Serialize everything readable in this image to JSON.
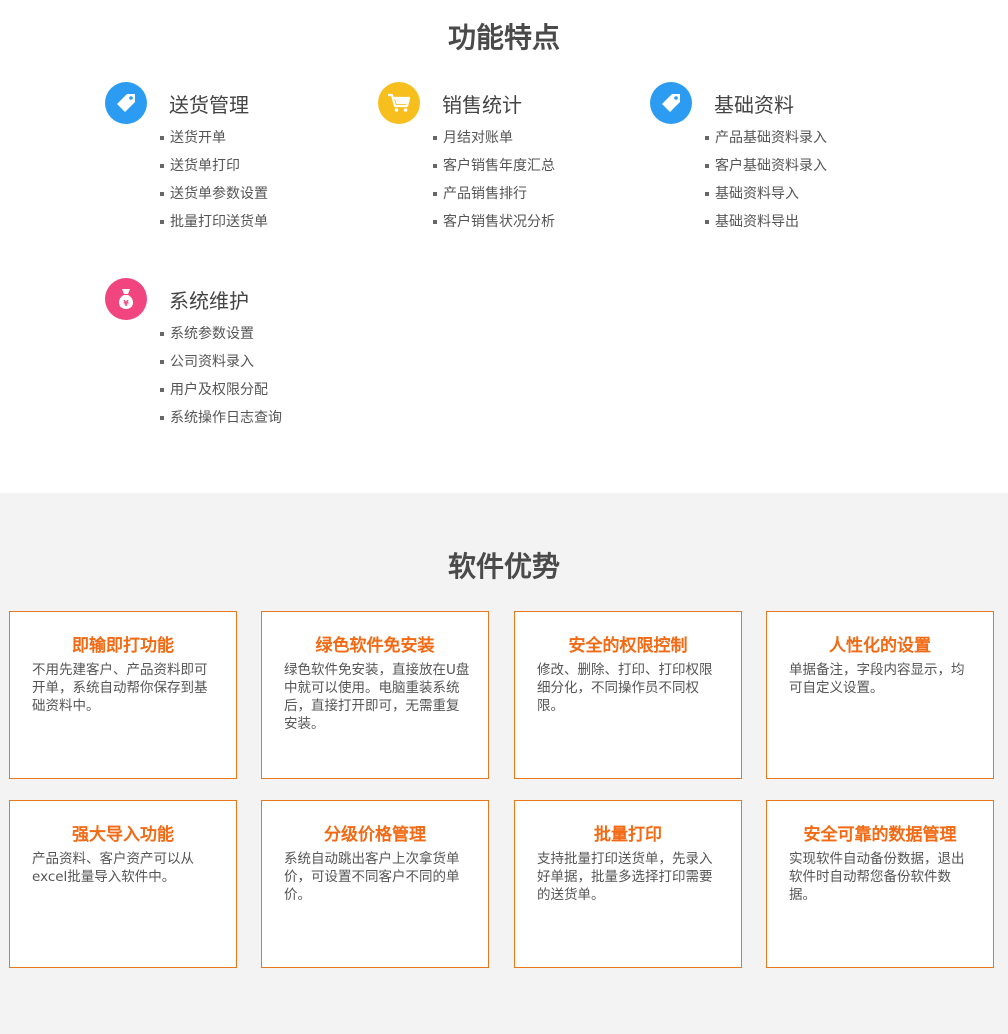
{
  "features": {
    "title": "功能特点",
    "groups": [
      {
        "name": "送货管理",
        "icon": "tag-icon",
        "color": "#2b9cf2",
        "items": [
          "送货开单",
          "送货单打印",
          "送货单参数设置",
          "批量打印送货单"
        ]
      },
      {
        "name": "销售统计",
        "icon": "shopping-cart-icon",
        "color": "#f7bf1e",
        "items": [
          "月结对账单",
          "客户销售年度汇总",
          "产品销售排行",
          "客户销售状况分析"
        ]
      },
      {
        "name": "基础资料",
        "icon": "tag-icon",
        "color": "#2b9cf2",
        "items": [
          "产品基础资料录入",
          "客户基础资料录入",
          "基础资料导入",
          "基础资料导出"
        ]
      },
      {
        "name": "系统维护",
        "icon": "money-bag-icon",
        "color": "#f0457f",
        "items": [
          "系统参数设置",
          "公司资料录入",
          "用户及权限分配",
          "系统操作日志查询"
        ]
      }
    ]
  },
  "advantages": {
    "title": "软件优势",
    "accent": "#f26a14",
    "cards": [
      {
        "title": "即输即打功能",
        "text": "不用先建客户、产品资料即可开单，系统自动帮你保存到基础资料中。"
      },
      {
        "title": "绿色软件免安装",
        "text": "绿色软件免安装，直接放在U盘中就可以使用。电脑重装系统后，直接打开即可，无需重复安装。"
      },
      {
        "title": "安全的权限控制",
        "text": "修改、删除、打印、打印权限细分化，不同操作员不同权限。"
      },
      {
        "title": "人性化的设置",
        "text": "单据备注，字段内容显示，均可自定义设置。"
      },
      {
        "title": "强大导入功能",
        "text": "产品资料、客户资产可以从excel批量导入软件中。"
      },
      {
        "title": "分级价格管理",
        "text": "系统自动跳出客户上次拿货单价，可设置不同客户不同的单价。"
      },
      {
        "title": "批量打印",
        "text": "支持批量打印送货单，先录入好单据，批量多选择打印需要的送货单。"
      },
      {
        "title": "安全可靠的数据管理",
        "text": "实现软件自动备份数据，退出软件时自动帮您备份软件数据。"
      }
    ]
  }
}
